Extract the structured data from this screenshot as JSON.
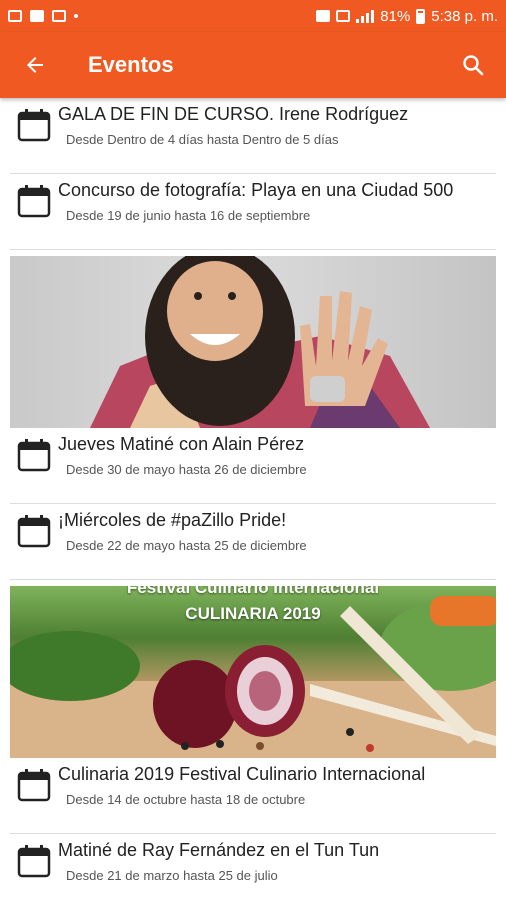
{
  "status_bar": {
    "battery": "81%",
    "time": "5:38 p. m."
  },
  "app_bar": {
    "title": "Eventos"
  },
  "events": [
    {
      "title": "GALA DE FIN DE CURSO. Irene Rodríguez",
      "dates": "Desde Dentro de 4 días hasta Dentro de 5 días"
    },
    {
      "title": "Concurso de fotografía: Playa en una Ciudad 500",
      "dates": "Desde 19 de junio hasta 16 de septiembre"
    },
    {
      "title": "Jueves Matiné con Alain Pérez",
      "dates": "Desde 30 de mayo hasta 26 de diciembre"
    },
    {
      "title": "¡Miércoles de #paZillo Pride!",
      "dates": "Desde 22 de mayo hasta 25 de diciembre"
    },
    {
      "title": "Culinaria 2019 Festival Culinario Internacional",
      "dates": "Desde 14 de octubre hasta 18 de octubre"
    },
    {
      "title": "Matiné de Ray Fernández en el Tun Tun",
      "dates": "Desde 21 de marzo hasta 25 de julio"
    }
  ],
  "banner_culinaria": {
    "line1": "Festival Culinario Internacional",
    "line2": "CULINARIA 2019"
  },
  "colors": {
    "accent": "#f05a22"
  },
  "icons": [
    "back-arrow-icon",
    "search-icon",
    "calendar-icon"
  ]
}
